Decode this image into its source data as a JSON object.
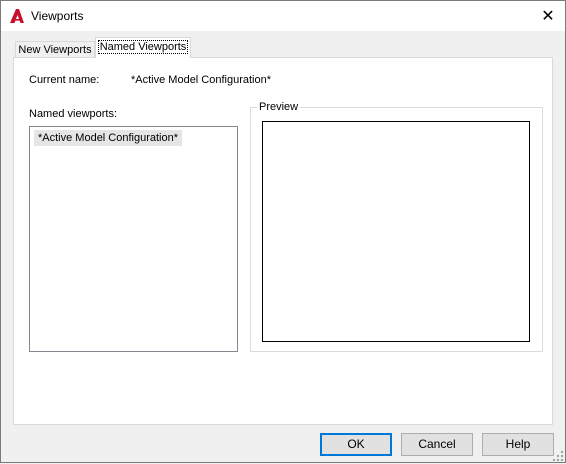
{
  "window": {
    "title": "Viewports",
    "icon": "autocad-a-icon",
    "close_glyph": "✕"
  },
  "tabs": [
    {
      "label": "New Viewports",
      "selected": false
    },
    {
      "label": "Named Viewports",
      "selected": true
    }
  ],
  "current": {
    "label": "Current name:",
    "value": "*Active Model Configuration*"
  },
  "named_viewports": {
    "label": "Named viewports:",
    "items": [
      "*Active Model Configuration*"
    ]
  },
  "preview": {
    "label": "Preview"
  },
  "buttons": {
    "ok": "OK",
    "cancel": "Cancel",
    "help": "Help"
  },
  "colors": {
    "accent": "#0078d7",
    "app_icon_red": "#c8102e"
  }
}
